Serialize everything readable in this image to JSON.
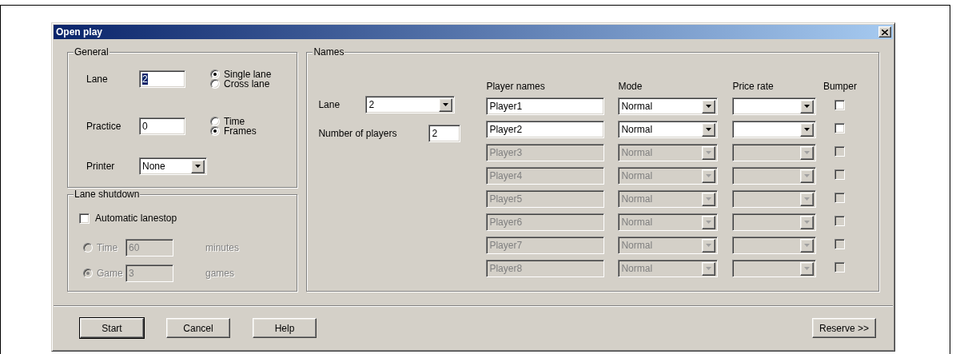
{
  "window": {
    "title": "Open play"
  },
  "general": {
    "title": "General",
    "lane": {
      "label": "Lane",
      "value": "2",
      "text_selected": true
    },
    "lane_type": [
      {
        "label": "Single lane",
        "selected": true
      },
      {
        "label": "Cross lane",
        "selected": false
      }
    ],
    "practice": {
      "label": "Practice",
      "value": "0",
      "text_selected": false
    },
    "practice_mode": [
      {
        "label": "Time",
        "selected": false
      },
      {
        "label": "Frames",
        "selected": true
      }
    ],
    "printer": {
      "label": "Printer",
      "value": "None"
    }
  },
  "lane_shutdown": {
    "title": "Lane shutdown",
    "automatic": {
      "label": "Automatic lanestop",
      "checked": false
    },
    "options": [
      {
        "label": "Time",
        "value": "60",
        "unit": "minutes",
        "selected": false,
        "disabled": true
      },
      {
        "label": "Game",
        "value": "3",
        "unit": "games",
        "selected": true,
        "disabled": true
      }
    ]
  },
  "names": {
    "title": "Names",
    "lane": {
      "label": "Lane",
      "value": "2"
    },
    "number_of_players": {
      "label": "Number of players",
      "value": "2"
    },
    "columns": [
      "Player names",
      "Mode",
      "Price rate",
      "Bumper"
    ],
    "players": [
      {
        "name": "Player1",
        "mode": "Normal",
        "bumper": false,
        "disabled": false
      },
      {
        "name": "Player2",
        "mode": "Normal",
        "bumper": false,
        "disabled": false
      },
      {
        "name": "Player3",
        "mode": "Normal",
        "bumper": false,
        "disabled": true
      },
      {
        "name": "Player4",
        "mode": "Normal",
        "bumper": false,
        "disabled": true
      },
      {
        "name": "Player5",
        "mode": "Normal",
        "bumper": false,
        "disabled": true
      },
      {
        "name": "Player6",
        "mode": "Normal",
        "bumper": false,
        "disabled": true
      },
      {
        "name": "Player7",
        "mode": "Normal",
        "bumper": false,
        "disabled": true
      },
      {
        "name": "Player8",
        "mode": "Normal",
        "bumper": false,
        "disabled": true
      }
    ]
  },
  "buttons": [
    {
      "label": "Start",
      "default": true
    },
    {
      "label": "Cancel",
      "default": false
    },
    {
      "label": "Help",
      "default": false
    }
  ],
  "reserve_button": {
    "label": "Reserve >>",
    "default": false
  }
}
